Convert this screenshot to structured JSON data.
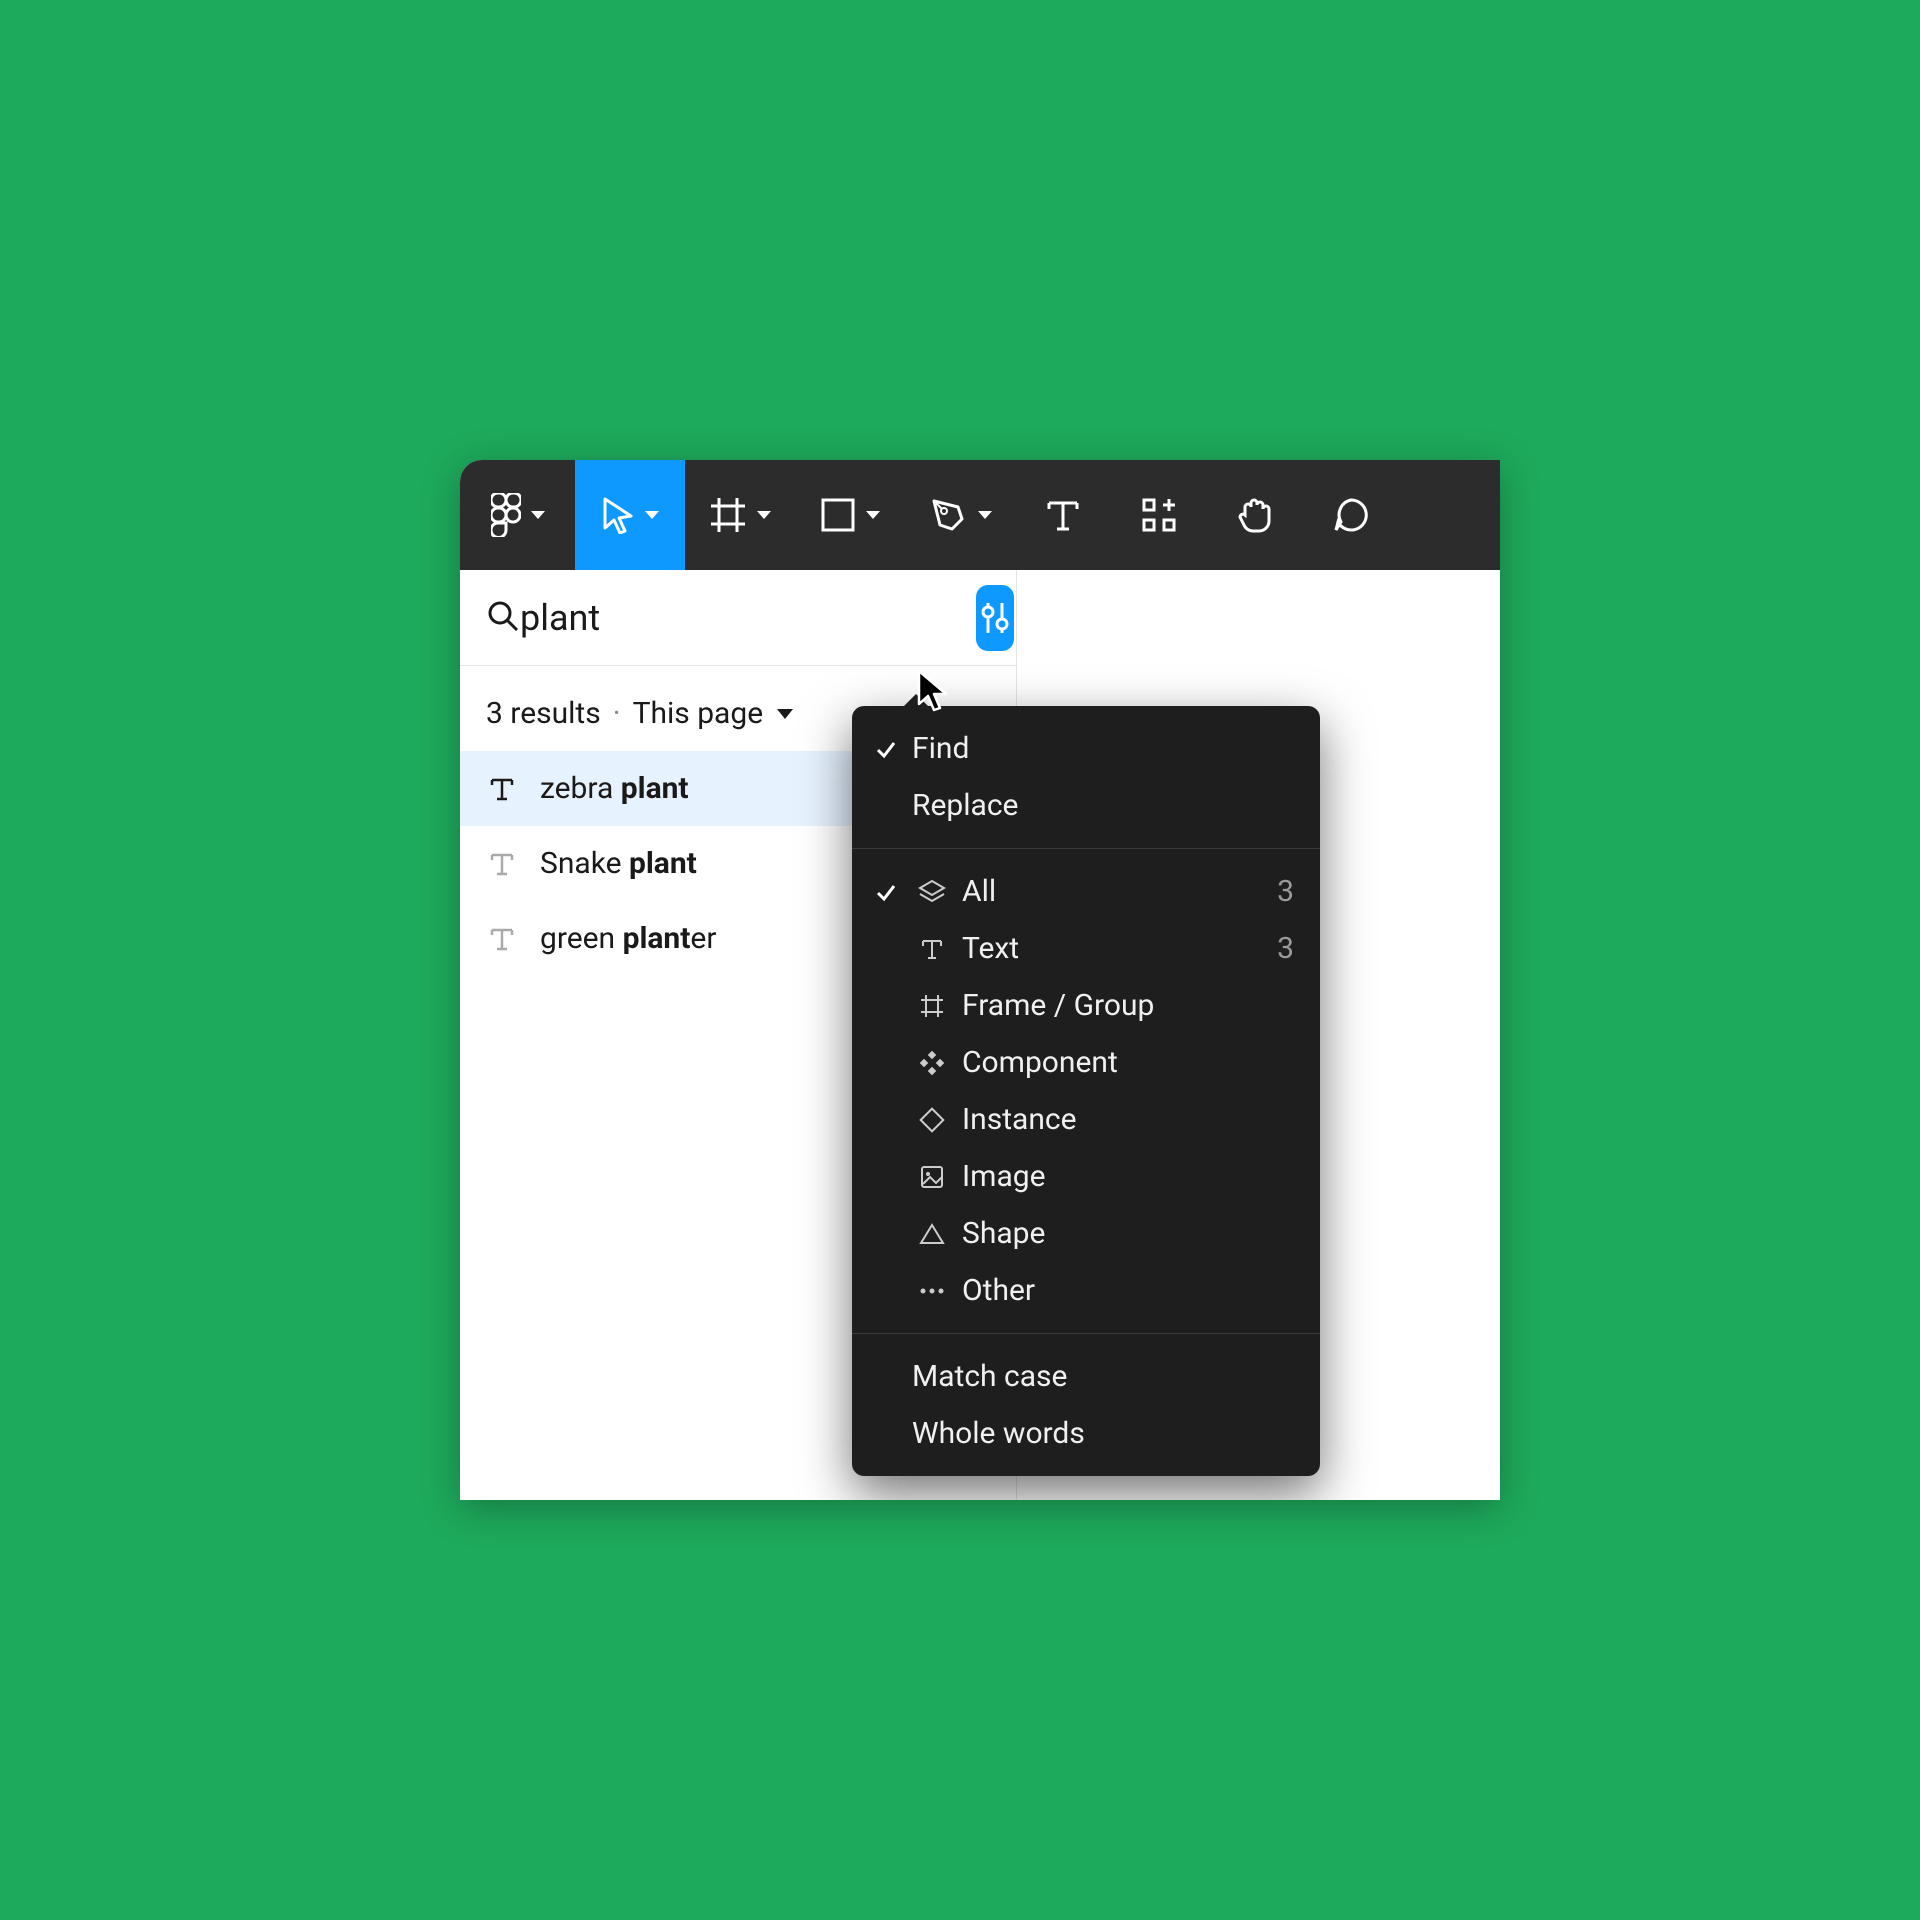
{
  "search": {
    "query": "plant",
    "results_label_count": "3 results",
    "scope_label": "This page"
  },
  "results": [
    {
      "pre": "zebra ",
      "match": "plant",
      "post": "",
      "selected": true
    },
    {
      "pre": "Snake ",
      "match": "plant",
      "post": "",
      "selected": false
    },
    {
      "pre": "green ",
      "match": "plant",
      "post": "er",
      "selected": false
    }
  ],
  "dropdown": {
    "modes": [
      {
        "label": "Find",
        "checked": true
      },
      {
        "label": "Replace",
        "checked": false
      }
    ],
    "filters": [
      {
        "icon": "layers",
        "label": "All",
        "count": "3",
        "checked": true
      },
      {
        "icon": "text",
        "label": "Text",
        "count": "3",
        "checked": false
      },
      {
        "icon": "frame",
        "label": "Frame / Group",
        "count": "",
        "checked": false
      },
      {
        "icon": "component",
        "label": "Component",
        "count": "",
        "checked": false
      },
      {
        "icon": "instance",
        "label": "Instance",
        "count": "",
        "checked": false
      },
      {
        "icon": "image",
        "label": "Image",
        "count": "",
        "checked": false
      },
      {
        "icon": "shape",
        "label": "Shape",
        "count": "",
        "checked": false
      },
      {
        "icon": "other",
        "label": "Other",
        "count": "",
        "checked": false
      }
    ],
    "options": [
      {
        "label": "Match case"
      },
      {
        "label": "Whole words"
      }
    ]
  }
}
